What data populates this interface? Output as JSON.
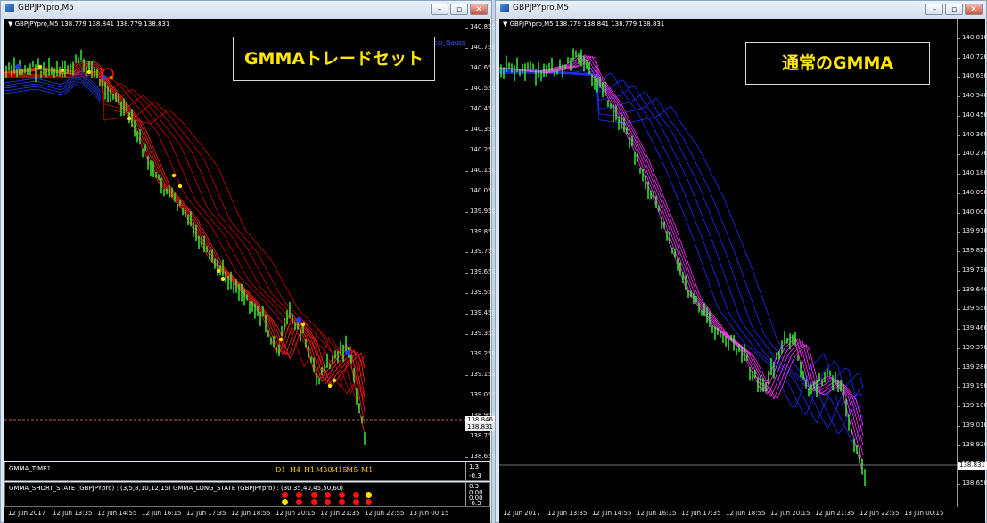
{
  "left": {
    "window_title": "GBPJPYpro,M5",
    "chart_info": "▼ GBPJPYpro,M5  138.779 138.841 138.779 138.831",
    "label": "GMMAトレードセット",
    "price_current": "138.846",
    "price_bid": "138.831",
    "legend_text": "cci_Gauss",
    "y_ticks": [
      "140.850",
      "140.750",
      "140.650",
      "140.550",
      "140.450",
      "140.350",
      "140.250",
      "140.150",
      "140.050",
      "139.950",
      "139.850",
      "139.750",
      "139.650",
      "139.550",
      "139.450",
      "139.350",
      "139.250",
      "139.150",
      "139.050",
      "138.950",
      "138.750",
      "138.650"
    ],
    "sub1": {
      "title": "GMMA_TIME1",
      "timeframes": [
        "D1",
        "H4",
        "H1",
        "M30",
        "M15",
        "M5",
        "M1"
      ],
      "scale": [
        "1.3",
        "-0.3"
      ]
    },
    "sub2": {
      "title": "GMMA_SHORT_STATE (GBPJPYpro) : (3,5,8,10,12,15)  GMMA_LONG_STATE (GBPJPYpro) : (30,35,40,45,50,60)",
      "scale": [
        "0.3",
        "0.00",
        "0.00",
        "-0.3"
      ]
    },
    "time_labels": [
      "12 Jun 2017",
      "12 Jun 13:35",
      "12 Jun 14:55",
      "12 Jun 16:15",
      "12 Jun 17:35",
      "12 Jun 18:55",
      "12 Jun 20:15",
      "12 Jun 21:35",
      "12 Jun 22:55",
      "13 Jun 00:15"
    ]
  },
  "right": {
    "window_title": "GBPJPYpro,M5",
    "chart_info": "▼ GBPJPYpro,M5  138.779 138.841 138.779 138.831",
    "label": "通常のGMMA",
    "price_bid": "138.831",
    "y_ticks": [
      "140.810",
      "140.720",
      "140.630",
      "140.540",
      "140.450",
      "140.360",
      "140.270",
      "140.180",
      "140.090",
      "140.000",
      "139.910",
      "139.820",
      "139.730",
      "139.640",
      "139.550",
      "139.460",
      "139.370",
      "139.280",
      "139.190",
      "139.100",
      "139.010",
      "138.920",
      "138.740",
      "138.650"
    ],
    "time_labels": [
      "12 Jun 2017",
      "12 Jun 13:35",
      "12 Jun 14:55",
      "12 Jun 16:15",
      "12 Jun 17:35",
      "12 Jun 18:55",
      "12 Jun 20:15",
      "12 Jun 21:35",
      "12 Jun 22:55",
      "13 Jun 00:15"
    ]
  },
  "window_buttons": {
    "minimize": "–",
    "restore": "▫",
    "close": "✕"
  },
  "colors": {
    "candle": "#33ff33",
    "short_left": "#ff2020",
    "long_left": "#c80000",
    "short_right": "#ff30ff",
    "long_right": "#1c2cff",
    "label_text": "#ffe600",
    "dot_red": "#ff1010",
    "dot_yellow": "#ffe400"
  }
}
